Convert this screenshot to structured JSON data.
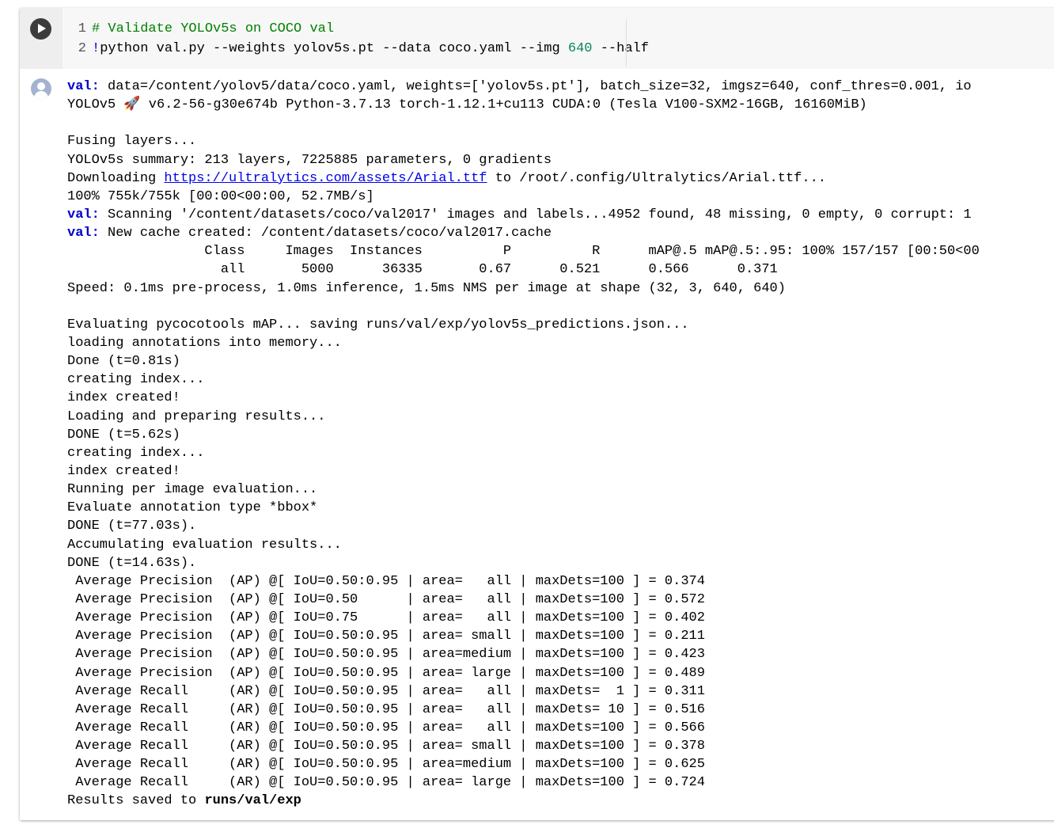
{
  "code": {
    "line_numbers": [
      "1",
      "2"
    ],
    "comment": "# Validate YOLOv5s on COCO val",
    "bang": "!",
    "cmd_before_num": "python val.py --weights yolov5s.pt --data coco.yaml --img ",
    "img_size": "640",
    "cmd_after_num": " --half"
  },
  "output": {
    "val_prefix": "val:",
    "args_line": " data=/content/yolov5/data/coco.yaml, weights=['yolov5s.pt'], batch_size=32, imgsz=640, conf_thres=0.001, io",
    "version_line": "YOLOv5 🚀 v6.2-56-g30e674b Python-3.7.13 torch-1.12.1+cu113 CUDA:0 (Tesla V100-SXM2-16GB, 16160MiB)",
    "fusing": "Fusing layers...",
    "summary": "YOLOv5s summary: 213 layers, 7225885 parameters, 0 gradients",
    "downloading_prefix": "Downloading ",
    "download_url": "https://ultralytics.com/assets/Arial.ttf",
    "downloading_suffix": " to /root/.config/Ultralytics/Arial.ttf...",
    "download_progress": "100% 755k/755k [00:00<00:00, 52.7MB/s]",
    "scanning": " Scanning '/content/datasets/coco/val2017' images and labels...4952 found, 48 missing, 0 empty, 0 corrupt: 1",
    "cache": " New cache created: /content/datasets/coco/val2017.cache",
    "table_header": "                 Class     Images  Instances          P          R      mAP@.5 mAP@.5:.95: 100% 157/157 [00:50<00",
    "table_row": "                   all       5000      36335       0.67      0.521      0.566      0.371",
    "speed": "Speed: 0.1ms pre-process, 1.0ms inference, 1.5ms NMS per image at shape (32, 3, 640, 640)",
    "log_lines": [
      "Evaluating pycocotools mAP... saving runs/val/exp/yolov5s_predictions.json...",
      "loading annotations into memory...",
      "Done (t=0.81s)",
      "creating index...",
      "index created!",
      "Loading and preparing results...",
      "DONE (t=5.62s)",
      "creating index...",
      "index created!",
      "Running per image evaluation...",
      "Evaluate annotation type *bbox*",
      "DONE (t=77.03s).",
      "Accumulating evaluation results...",
      "DONE (t=14.63s)."
    ],
    "metrics": [
      " Average Precision  (AP) @[ IoU=0.50:0.95 | area=   all | maxDets=100 ] = 0.374",
      " Average Precision  (AP) @[ IoU=0.50      | area=   all | maxDets=100 ] = 0.572",
      " Average Precision  (AP) @[ IoU=0.75      | area=   all | maxDets=100 ] = 0.402",
      " Average Precision  (AP) @[ IoU=0.50:0.95 | area= small | maxDets=100 ] = 0.211",
      " Average Precision  (AP) @[ IoU=0.50:0.95 | area=medium | maxDets=100 ] = 0.423",
      " Average Precision  (AP) @[ IoU=0.50:0.95 | area= large | maxDets=100 ] = 0.489",
      " Average Recall     (AR) @[ IoU=0.50:0.95 | area=   all | maxDets=  1 ] = 0.311",
      " Average Recall     (AR) @[ IoU=0.50:0.95 | area=   all | maxDets= 10 ] = 0.516",
      " Average Recall     (AR) @[ IoU=0.50:0.95 | area=   all | maxDets=100 ] = 0.566",
      " Average Recall     (AR) @[ IoU=0.50:0.95 | area= small | maxDets=100 ] = 0.378",
      " Average Recall     (AR) @[ IoU=0.50:0.95 | area=medium | maxDets=100 ] = 0.625",
      " Average Recall     (AR) @[ IoU=0.50:0.95 | area= large | maxDets=100 ] = 0.724"
    ],
    "results_prefix": "Results saved to ",
    "results_path": "runs/val/exp"
  }
}
